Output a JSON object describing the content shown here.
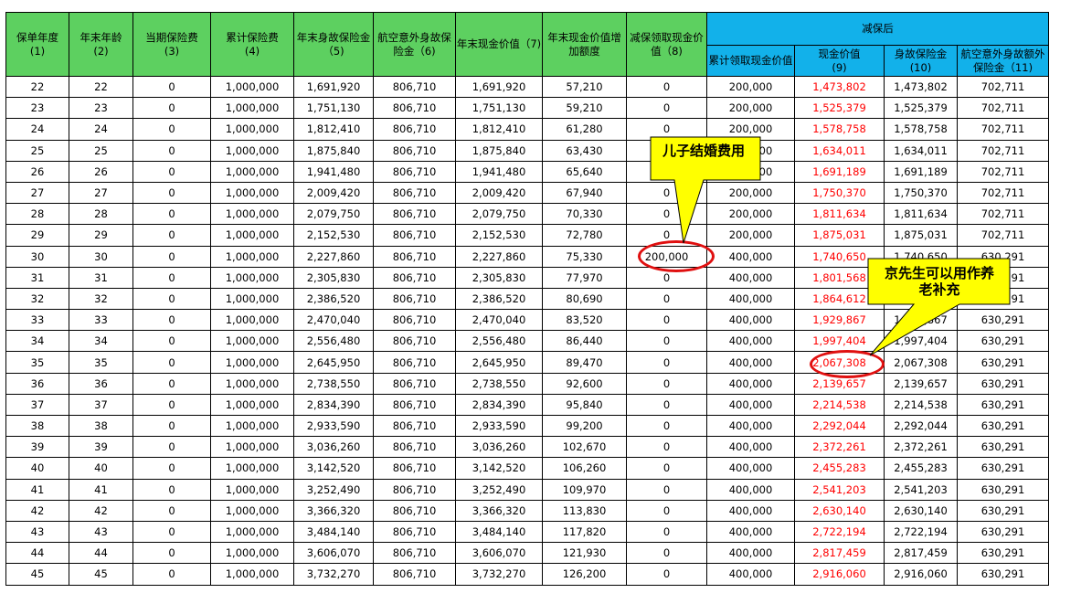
{
  "headers": {
    "policy_year": "保单年度\n(1)",
    "age": "年末年龄\n(2)",
    "premium": "当期保险费\n(3)",
    "cum_premium": "累计保险费\n(4)",
    "death_benefit": "年末身故保险金（5)",
    "air_benefit": "航空意外身故保险金（6)",
    "cash_value": "年末现金价值（7)",
    "cv_increase": "年末现金价值增加额度",
    "withdrawal": "减保领取现金价值（8)",
    "after_group": "减保后",
    "after_cum": "累计领取现金价值",
    "after_cv": "现金价值\n(9)",
    "after_death": "身故保险金\n(10)",
    "after_air": "航空意外身故额外保险金（11)"
  },
  "rows": [
    [
      "22",
      "22",
      "0",
      "1,000,000",
      "1,691,920",
      "806,710",
      "1,691,920",
      "57,210",
      "0",
      "200,000",
      "1,473,802",
      "1,473,802",
      "702,711"
    ],
    [
      "23",
      "23",
      "0",
      "1,000,000",
      "1,751,130",
      "806,710",
      "1,751,130",
      "59,210",
      "0",
      "200,000",
      "1,525,379",
      "1,525,379",
      "702,711"
    ],
    [
      "24",
      "24",
      "0",
      "1,000,000",
      "1,812,410",
      "806,710",
      "1,812,410",
      "61,280",
      "0",
      "200,000",
      "1,578,758",
      "1,578,758",
      "702,711"
    ],
    [
      "25",
      "25",
      "0",
      "1,000,000",
      "1,875,840",
      "806,710",
      "1,875,840",
      "63,430",
      "0",
      "200,000",
      "1,634,011",
      "1,634,011",
      "702,711"
    ],
    [
      "26",
      "26",
      "0",
      "1,000,000",
      "1,941,480",
      "806,710",
      "1,941,480",
      "65,640",
      "0",
      "200,000",
      "1,691,189",
      "1,691,189",
      "702,711"
    ],
    [
      "27",
      "27",
      "0",
      "1,000,000",
      "2,009,420",
      "806,710",
      "2,009,420",
      "67,940",
      "0",
      "200,000",
      "1,750,370",
      "1,750,370",
      "702,711"
    ],
    [
      "28",
      "28",
      "0",
      "1,000,000",
      "2,079,750",
      "806,710",
      "2,079,750",
      "70,330",
      "0",
      "200,000",
      "1,811,634",
      "1,811,634",
      "702,711"
    ],
    [
      "29",
      "29",
      "0",
      "1,000,000",
      "2,152,530",
      "806,710",
      "2,152,530",
      "72,780",
      "0",
      "200,000",
      "1,875,031",
      "1,875,031",
      "702,711"
    ],
    [
      "30",
      "30",
      "0",
      "1,000,000",
      "2,227,860",
      "806,710",
      "2,227,860",
      "75,330",
      "200,000",
      "400,000",
      "1,740,650",
      "1,740,650",
      "630,291"
    ],
    [
      "31",
      "31",
      "0",
      "1,000,000",
      "2,305,830",
      "806,710",
      "2,305,830",
      "77,970",
      "0",
      "400,000",
      "1,801,568",
      "1,801,568",
      "630,291"
    ],
    [
      "32",
      "32",
      "0",
      "1,000,000",
      "2,386,520",
      "806,710",
      "2,386,520",
      "80,690",
      "0",
      "400,000",
      "1,864,612",
      "1,864,612",
      "630,291"
    ],
    [
      "33",
      "33",
      "0",
      "1,000,000",
      "2,470,040",
      "806,710",
      "2,470,040",
      "83,520",
      "0",
      "400,000",
      "1,929,867",
      "1,929,867",
      "630,291"
    ],
    [
      "34",
      "34",
      "0",
      "1,000,000",
      "2,556,480",
      "806,710",
      "2,556,480",
      "86,440",
      "0",
      "400,000",
      "1,997,404",
      "1,997,404",
      "630,291"
    ],
    [
      "35",
      "35",
      "0",
      "1,000,000",
      "2,645,950",
      "806,710",
      "2,645,950",
      "89,470",
      "0",
      "400,000",
      "2,067,308",
      "2,067,308",
      "630,291"
    ],
    [
      "36",
      "36",
      "0",
      "1,000,000",
      "2,738,550",
      "806,710",
      "2,738,550",
      "92,600",
      "0",
      "400,000",
      "2,139,657",
      "2,139,657",
      "630,291"
    ],
    [
      "37",
      "37",
      "0",
      "1,000,000",
      "2,834,390",
      "806,710",
      "2,834,390",
      "95,840",
      "0",
      "400,000",
      "2,214,538",
      "2,214,538",
      "630,291"
    ],
    [
      "38",
      "38",
      "0",
      "1,000,000",
      "2,933,590",
      "806,710",
      "2,933,590",
      "99,200",
      "0",
      "400,000",
      "2,292,044",
      "2,292,044",
      "630,291"
    ],
    [
      "39",
      "39",
      "0",
      "1,000,000",
      "3,036,260",
      "806,710",
      "3,036,260",
      "102,670",
      "0",
      "400,000",
      "2,372,261",
      "2,372,261",
      "630,291"
    ],
    [
      "40",
      "40",
      "0",
      "1,000,000",
      "3,142,520",
      "806,710",
      "3,142,520",
      "106,260",
      "0",
      "400,000",
      "2,455,283",
      "2,455,283",
      "630,291"
    ],
    [
      "41",
      "41",
      "0",
      "1,000,000",
      "3,252,490",
      "806,710",
      "3,252,490",
      "109,970",
      "0",
      "400,000",
      "2,541,203",
      "2,541,203",
      "630,291"
    ],
    [
      "42",
      "42",
      "0",
      "1,000,000",
      "3,366,320",
      "806,710",
      "3,366,320",
      "113,830",
      "0",
      "400,000",
      "2,630,140",
      "2,630,140",
      "630,291"
    ],
    [
      "43",
      "43",
      "0",
      "1,000,000",
      "3,484,140",
      "806,710",
      "3,484,140",
      "117,820",
      "0",
      "400,000",
      "2,722,194",
      "2,722,194",
      "630,291"
    ],
    [
      "44",
      "44",
      "0",
      "1,000,000",
      "3,606,070",
      "806,710",
      "3,606,070",
      "121,930",
      "0",
      "400,000",
      "2,817,459",
      "2,817,459",
      "630,291"
    ],
    [
      "45",
      "45",
      "0",
      "1,000,000",
      "3,732,270",
      "806,710",
      "3,732,270",
      "126,200",
      "0",
      "400,000",
      "2,916,060",
      "2,916,060",
      "630,291"
    ]
  ],
  "callouts": {
    "wedding": "儿子结婚费用",
    "retirement": "京先生可以用作养老补充"
  },
  "colors": {
    "header_green": "#5dd060",
    "header_blue": "#12b1ea",
    "callout_fill": "#ffff00",
    "highlight_red": "#ff0000"
  }
}
